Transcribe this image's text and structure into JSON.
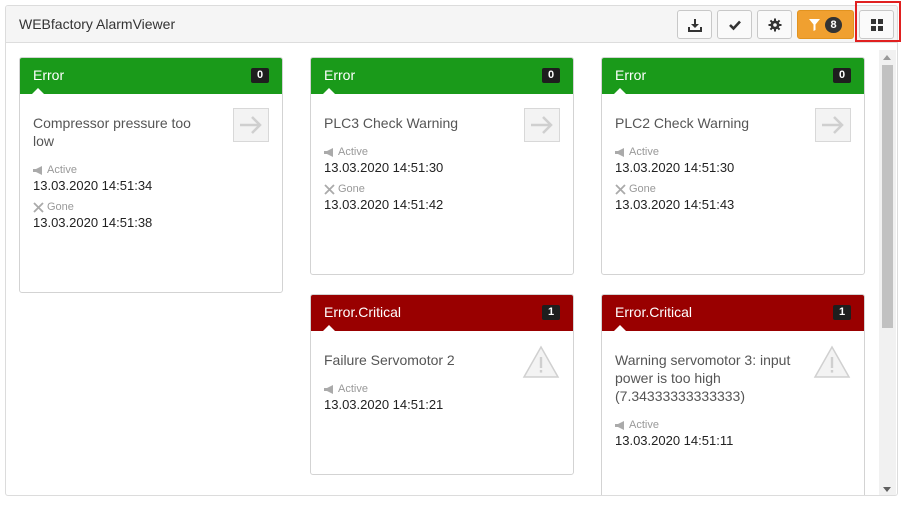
{
  "app": {
    "title": "WEBfactory AlarmViewer"
  },
  "toolbar": {
    "filter_count": "8"
  },
  "cards": [
    {
      "category": "Error",
      "count": "0",
      "message": "Compressor pressure too low",
      "active_label": "Active",
      "active_time": "13.03.2020 14:51:34",
      "gone_label": "Gone",
      "gone_time": "13.03.2020 14:51:38"
    },
    {
      "category": "Error",
      "count": "0",
      "message": "PLC3 Check Warning",
      "active_label": "Active",
      "active_time": "13.03.2020 14:51:30",
      "gone_label": "Gone",
      "gone_time": "13.03.2020 14:51:42"
    },
    {
      "category": "Error",
      "count": "0",
      "message": "PLC2 Check Warning",
      "active_label": "Active",
      "active_time": "13.03.2020 14:51:30",
      "gone_label": "Gone",
      "gone_time": "13.03.2020 14:51:43"
    },
    {
      "category": "Error.Critical",
      "count": "1",
      "message": "Failure Servomotor 2",
      "active_label": "Active",
      "active_time": "13.03.2020 14:51:21"
    },
    {
      "category": "Error.Critical",
      "count": "1",
      "message": "Warning servomotor 3: input power is too high (7.34333333333333)",
      "active_label": "Active",
      "active_time": "13.03.2020 14:51:11"
    }
  ],
  "colors": {
    "error": "#1a9a1a",
    "critical": "#990000",
    "filter": "#f0a030"
  }
}
